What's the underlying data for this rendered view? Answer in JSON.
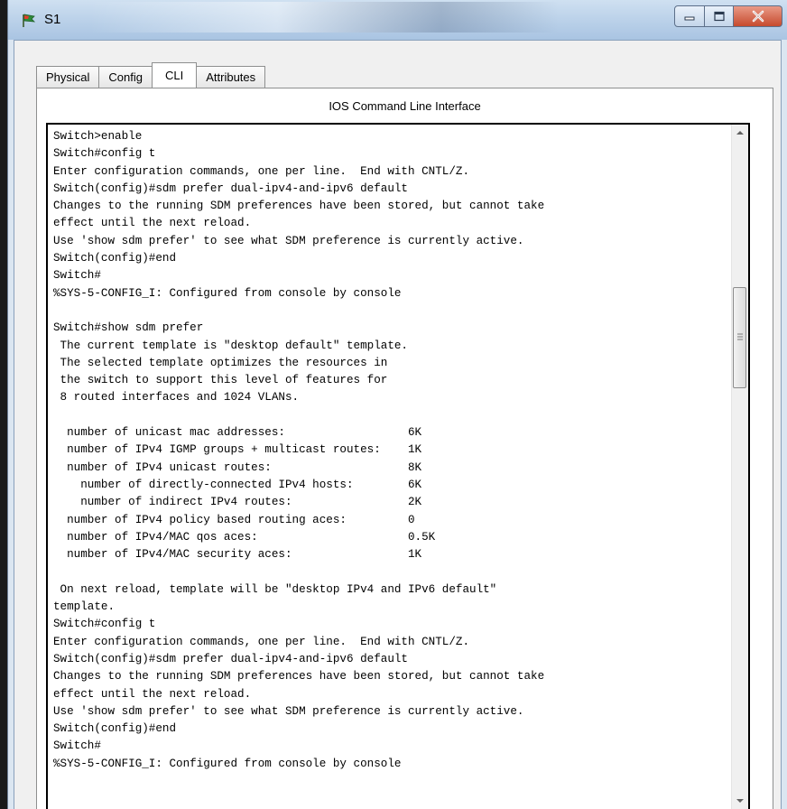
{
  "window": {
    "title": "S1",
    "controls": {
      "minimize": "minimize",
      "maximize": "maximize",
      "close": "close"
    }
  },
  "tabs": [
    {
      "label": "Physical",
      "active": false
    },
    {
      "label": "Config",
      "active": false
    },
    {
      "label": "CLI",
      "active": true
    },
    {
      "label": "Attributes",
      "active": false
    }
  ],
  "panel": {
    "title": "IOS Command Line Interface"
  },
  "terminal": {
    "lines": [
      "Switch>enable",
      "Switch#config t",
      "Enter configuration commands, one per line.  End with CNTL/Z.",
      "Switch(config)#sdm prefer dual-ipv4-and-ipv6 default",
      "Changes to the running SDM preferences have been stored, but cannot take",
      "effect until the next reload.",
      "Use 'show sdm prefer' to see what SDM preference is currently active.",
      "Switch(config)#end",
      "Switch#",
      "%SYS-5-CONFIG_I: Configured from console by console",
      "",
      "Switch#show sdm prefer",
      " The current template is \"desktop default\" template.",
      " The selected template optimizes the resources in",
      " the switch to support this level of features for",
      " 8 routed interfaces and 1024 VLANs.",
      "",
      "  number of unicast mac addresses:                  6K",
      "  number of IPv4 IGMP groups + multicast routes:    1K",
      "  number of IPv4 unicast routes:                    8K",
      "    number of directly-connected IPv4 hosts:        6K",
      "    number of indirect IPv4 routes:                 2K",
      "  number of IPv4 policy based routing aces:         0",
      "  number of IPv4/MAC qos aces:                      0.5K",
      "  number of IPv4/MAC security aces:                 1K",
      "",
      " On next reload, template will be \"desktop IPv4 and IPv6 default\"",
      "template.",
      "Switch#config t",
      "Enter configuration commands, one per line.  End with CNTL/Z.",
      "Switch(config)#sdm prefer dual-ipv4-and-ipv6 default",
      "Changes to the running SDM preferences have been stored, but cannot take",
      "effect until the next reload.",
      "Use 'show sdm prefer' to see what SDM preference is currently active.",
      "Switch(config)#end",
      "Switch#",
      "%SYS-5-CONFIG_I: Configured from console by console"
    ]
  },
  "icons": {
    "app": "packet-tracer-switch-icon",
    "scroll_up": "scroll-up-arrow-icon",
    "scroll_down": "scroll-down-arrow-icon"
  },
  "colors": {
    "close_button": "#c64a2d",
    "titlebar": "#bdd3ea"
  }
}
